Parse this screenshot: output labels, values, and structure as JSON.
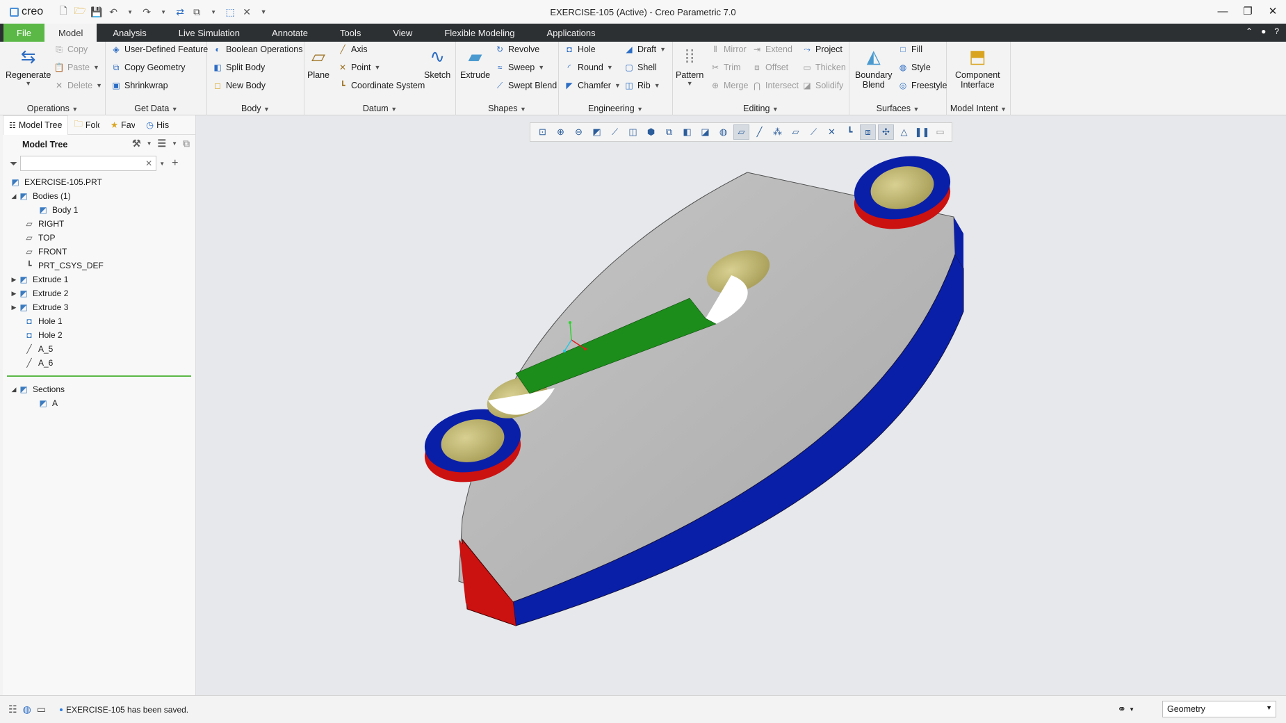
{
  "app": {
    "logo_text": "creo",
    "window_title": "EXERCISE-105 (Active) - Creo Parametric 7.0"
  },
  "menubar": {
    "tabs": [
      {
        "label": "File"
      },
      {
        "label": "Model"
      },
      {
        "label": "Analysis"
      },
      {
        "label": "Live Simulation"
      },
      {
        "label": "Annotate"
      },
      {
        "label": "Tools"
      },
      {
        "label": "View"
      },
      {
        "label": "Flexible Modeling"
      },
      {
        "label": "Applications"
      }
    ],
    "active_tab": "Model"
  },
  "ribbon": {
    "operations": {
      "label": "Operations",
      "regenerate": "Regenerate",
      "copy": "Copy",
      "paste": "Paste",
      "delete": "Delete"
    },
    "get_data": {
      "label": "Get Data",
      "udf": "User-Defined Feature",
      "copy_geometry": "Copy Geometry",
      "shrinkwrap": "Shrinkwrap"
    },
    "body": {
      "label": "Body",
      "boolean": "Boolean Operations",
      "split": "Split Body",
      "new_body": "New Body"
    },
    "datum": {
      "label": "Datum",
      "plane": "Plane",
      "axis": "Axis",
      "point": "Point",
      "csys": "Coordinate System",
      "sketch": "Sketch"
    },
    "shapes": {
      "label": "Shapes",
      "extrude": "Extrude",
      "revolve": "Revolve",
      "sweep": "Sweep",
      "swept_blend": "Swept Blend"
    },
    "engineering": {
      "label": "Engineering",
      "hole": "Hole",
      "round": "Round",
      "chamfer": "Chamfer",
      "draft": "Draft",
      "shell": "Shell",
      "rib": "Rib"
    },
    "editing": {
      "label": "Editing",
      "pattern": "Pattern",
      "mirror": "Mirror",
      "trim": "Trim",
      "merge": "Merge",
      "extend": "Extend",
      "offset": "Offset",
      "intersect": "Intersect",
      "project": "Project",
      "thicken": "Thicken",
      "solidify": "Solidify"
    },
    "surfaces": {
      "label": "Surfaces",
      "boundary_blend_1": "Boundary",
      "boundary_blend_2": "Blend",
      "fill": "Fill",
      "style": "Style",
      "freestyle": "Freestyle"
    },
    "model_intent": {
      "label": "Model Intent",
      "component_1": "Component",
      "component_2": "Interface"
    }
  },
  "left_panel": {
    "tabs": [
      {
        "label": "Model Tree"
      },
      {
        "label": "Fold"
      },
      {
        "label": "Fav"
      },
      {
        "label": "His"
      }
    ],
    "title": "Model Tree",
    "search_value": "",
    "tree": [
      {
        "label": "EXERCISE-105.PRT",
        "icon": "part-icon"
      },
      {
        "label": "Bodies (1)",
        "icon": "bodies-icon"
      },
      {
        "label": "Body 1",
        "icon": "body-icon"
      },
      {
        "label": "RIGHT",
        "icon": "datum-plane-icon"
      },
      {
        "label": "TOP",
        "icon": "datum-plane-icon"
      },
      {
        "label": "FRONT",
        "icon": "datum-plane-icon"
      },
      {
        "label": "PRT_CSYS_DEF",
        "icon": "csys-icon"
      },
      {
        "label": "Extrude 1",
        "icon": "extrude-icon"
      },
      {
        "label": "Extrude 2",
        "icon": "extrude-icon"
      },
      {
        "label": "Extrude 3",
        "icon": "extrude-icon"
      },
      {
        "label": "Hole 1",
        "icon": "hole-icon"
      },
      {
        "label": "Hole 2",
        "icon": "hole-icon"
      },
      {
        "label": "A_5",
        "icon": "axis-icon"
      },
      {
        "label": "A_6",
        "icon": "axis-icon"
      }
    ],
    "sections_tree": [
      {
        "label": "Sections",
        "icon": "sections-icon"
      },
      {
        "label": "A",
        "icon": "section-icon"
      }
    ]
  },
  "statusbar": {
    "message": "EXERCISE-105 has been saved.",
    "filter_value": "Geometry"
  },
  "colors": {
    "file_tab": "#5bb846",
    "menubar": "#2d3033",
    "viewport_bg": "#e6e8eb",
    "part_gray": "#b4b4b4",
    "part_blue": "#0a1fa8",
    "part_red": "#cc1111",
    "part_green": "#1c8c1a",
    "part_yellow": "#c9c07a"
  }
}
